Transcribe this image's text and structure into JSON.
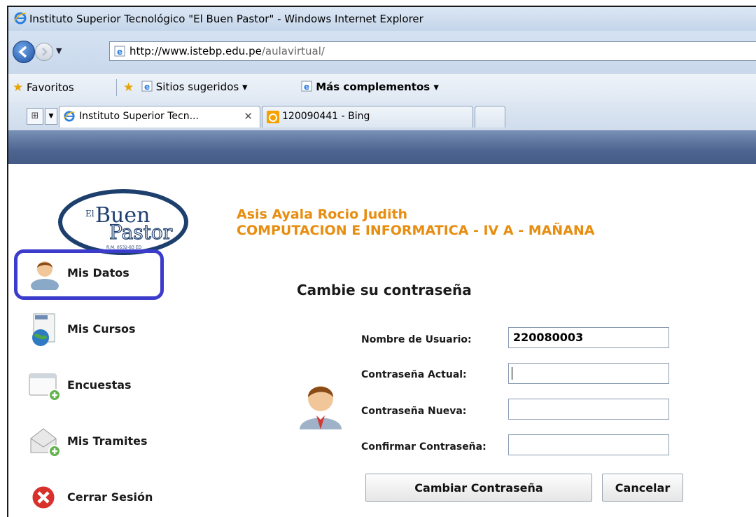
{
  "window": {
    "title": "Instituto Superior Tecnológico \"El Buen Pastor\" - Windows Internet Explorer"
  },
  "address": {
    "url_domain": "http://www.istebp.edu.pe",
    "url_path": "/aulavirtual/"
  },
  "favorites": {
    "favoritos": "Favoritos",
    "sitios": "Sitios sugeridos ▾",
    "complementos": "Más complementos ▾"
  },
  "tabs": [
    {
      "label": "Instituto Superior Tecn...",
      "close": "✕"
    },
    {
      "label": "120090441 - Bing"
    }
  ],
  "logo": {
    "text_el": "El",
    "text_buen": "Buen",
    "text_pastor": "Pastor",
    "text_small": "R.M. 0532-83 ED"
  },
  "user": {
    "name": "Asis Ayala Rocio Judith",
    "course": "COMPUTACION E INFORMATICA - IV A - MAÑANA"
  },
  "menu": [
    {
      "label": "Mis Datos",
      "icon": "user-icon"
    },
    {
      "label": "Mis Cursos",
      "icon": "globe-document-icon"
    },
    {
      "label": "Encuestas",
      "icon": "window-add-icon"
    },
    {
      "label": "Mis Tramites",
      "icon": "envelope-add-icon"
    },
    {
      "label": "Cerrar Sesión",
      "icon": "close-circle-icon"
    }
  ],
  "form": {
    "title": "Cambie su contraseña",
    "fields": [
      {
        "label": "Nombre de Usuario:",
        "value": "220080003"
      },
      {
        "label": "Contraseña Actual:",
        "value": ""
      },
      {
        "label": "Contraseña Nueva:",
        "value": ""
      },
      {
        "label": "Confirmar Contraseña:",
        "value": ""
      }
    ],
    "submit": "Cambiar Contraseña",
    "cancel": "Cancelar"
  },
  "colors": {
    "accent_orange": "#E78D10",
    "highlight_blue": "#3C3CCC",
    "banner": "#4D6590"
  }
}
